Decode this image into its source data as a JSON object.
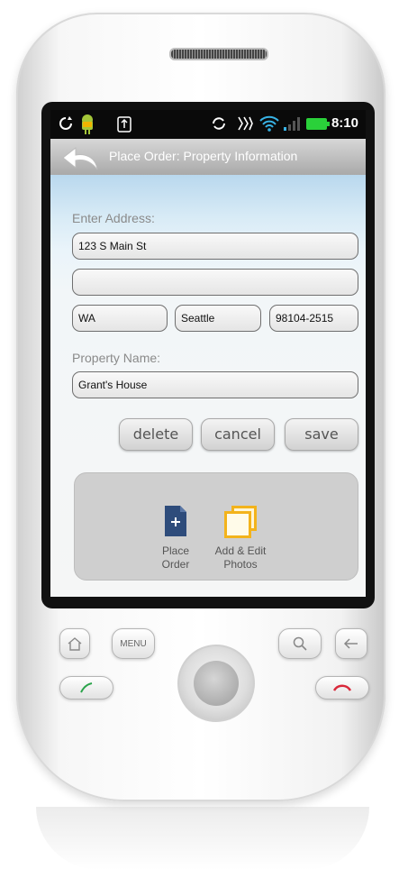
{
  "status_bar": {
    "time": "8:10",
    "icons": [
      "sync-icon",
      "android-icon",
      "usb-icon",
      "refresh-icon",
      "vibrate-icon",
      "wifi-icon",
      "signal-icon",
      "battery-icon"
    ]
  },
  "title_bar": {
    "title": "Place Order: Property Information"
  },
  "form": {
    "address_label": "Enter Address:",
    "address_line1": "123 S Main St",
    "address_line2": "",
    "state": "WA",
    "city": "Seattle",
    "zip": "98104-2515",
    "property_name_label": "Property Name:",
    "property_name": "Grant's House"
  },
  "buttons": {
    "delete": "delete",
    "cancel": "cancel",
    "save": "save"
  },
  "actions": [
    {
      "line1": "Place",
      "line2": "Order",
      "icon": "document-plus-icon",
      "color": "#2e4c7b"
    },
    {
      "line1": "Add & Edit",
      "line2": "Photos",
      "icon": "photos-icon",
      "color": "#f3b31b"
    }
  ],
  "hardware": {
    "menu_label": "MENU",
    "home_icon": "home-icon",
    "search_icon": "search-icon",
    "back_icon": "back-icon",
    "call_icon": "call-icon",
    "end_call_icon": "end-call-icon"
  },
  "colors": {
    "status_bar": "#0a0a0a",
    "battery": "#2ad13a",
    "wifi": "#38b3e6",
    "call_green": "#2aa34a",
    "end_red": "#d9283a"
  }
}
